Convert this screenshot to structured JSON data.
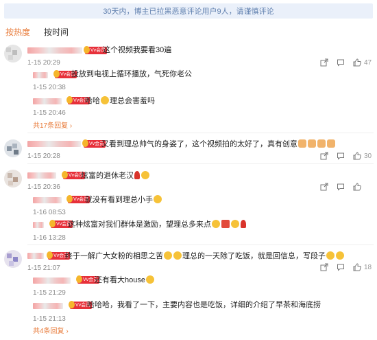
{
  "notice": "30天内，博主已拉黑恶意评论用户9人，请谨慎评论",
  "sort": {
    "hot": "按热度",
    "time": "按时间"
  },
  "badge": "Vv会员",
  "comments": [
    {
      "text": "这个视频我要看30遍",
      "time": "1-15 20:29",
      "likes": "47",
      "replies": [
        {
          "text": "投放到电视上循环播放，气死你老公",
          "time": "1-15 20:38"
        },
        {
          "text_a": "哈哈",
          "text_b": "理总会害羞吗",
          "time": "1-15 20:46"
        }
      ],
      "more": "共17条回复"
    },
    {
      "text": "又看到理总帅气的身姿了，这个视频拍的太好了，真有创意",
      "time": "1-15 20:28",
      "likes": "30"
    },
    {
      "text": "炫富的退休老汉",
      "time": "1-15 20:36",
      "likes": "",
      "replies": [
        {
          "text": "就没有看到理总小手",
          "time": "1-16 08:53"
        },
        {
          "text": "这种炫富对我们群体是激励，望理总多来点",
          "time": "1-16 13:28"
        }
      ]
    },
    {
      "text_a": "终于一解广大女粉的相思之苦",
      "text_b": "理总的一天除了吃饭，就是回信息，写段子",
      "time": "1-15 21:07",
      "likes": "18",
      "replies": [
        {
          "text": "还有看大house",
          "time": "1-15 21:29"
        },
        {
          "text": "哈哈哈，我看了一下，主要内容也是吃饭，详细的介绍了早茶和海底捞",
          "time": "1-15 21:13"
        }
      ],
      "more": "共4条回复"
    }
  ],
  "colors": {
    "accent": "#e87b3a",
    "notice_bg": "#eaf0fa",
    "notice_text": "#5f7fae",
    "badge": "#e7303a"
  },
  "icons": [
    "share-icon",
    "comment-icon",
    "like-icon"
  ]
}
